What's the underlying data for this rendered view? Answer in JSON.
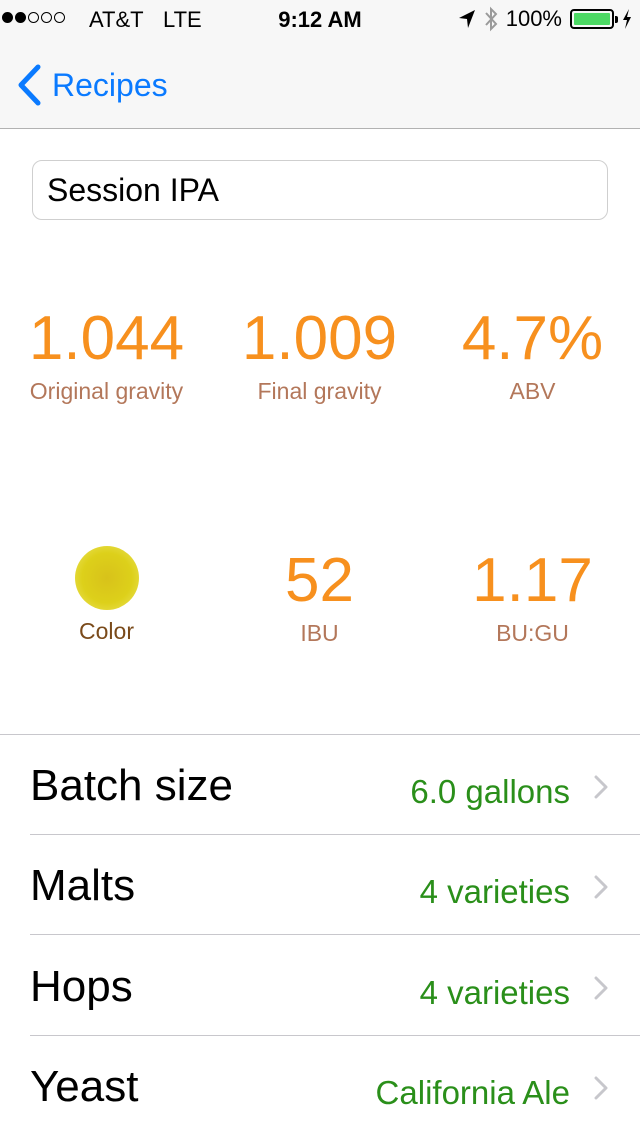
{
  "status_bar": {
    "signal": "●●○○○",
    "carrier": "AT&T",
    "network": "LTE",
    "time": "9:12 AM",
    "battery": "100%",
    "icons": [
      "location-arrow-icon",
      "bluetooth-icon",
      "battery-icon",
      "charging-bolt-icon"
    ]
  },
  "nav": {
    "back_label": "Recipes"
  },
  "recipe": {
    "name": "Session IPA"
  },
  "stats": {
    "og": {
      "value": "1.044",
      "label": "Original gravity"
    },
    "fg": {
      "value": "1.009",
      "label": "Final gravity"
    },
    "abv": {
      "value": "4.7%",
      "label": "ABV"
    },
    "color": {
      "label": "Color",
      "swatch": "#dccb1c"
    },
    "ibu": {
      "value": "52",
      "label": "IBU"
    },
    "bugu": {
      "value": "1.17",
      "label": "BU:GU"
    }
  },
  "rows": [
    {
      "title": "Batch size",
      "value": "6.0 gallons"
    },
    {
      "title": "Malts",
      "value": "4 varieties"
    },
    {
      "title": "Hops",
      "value": "4 varieties"
    },
    {
      "title": "Yeast",
      "value": "California Ale"
    }
  ],
  "colors": {
    "accent": "#0a7aff",
    "stat_value": "#f7901e",
    "stat_label": "#b3775a",
    "row_value": "#2a8f1a"
  }
}
